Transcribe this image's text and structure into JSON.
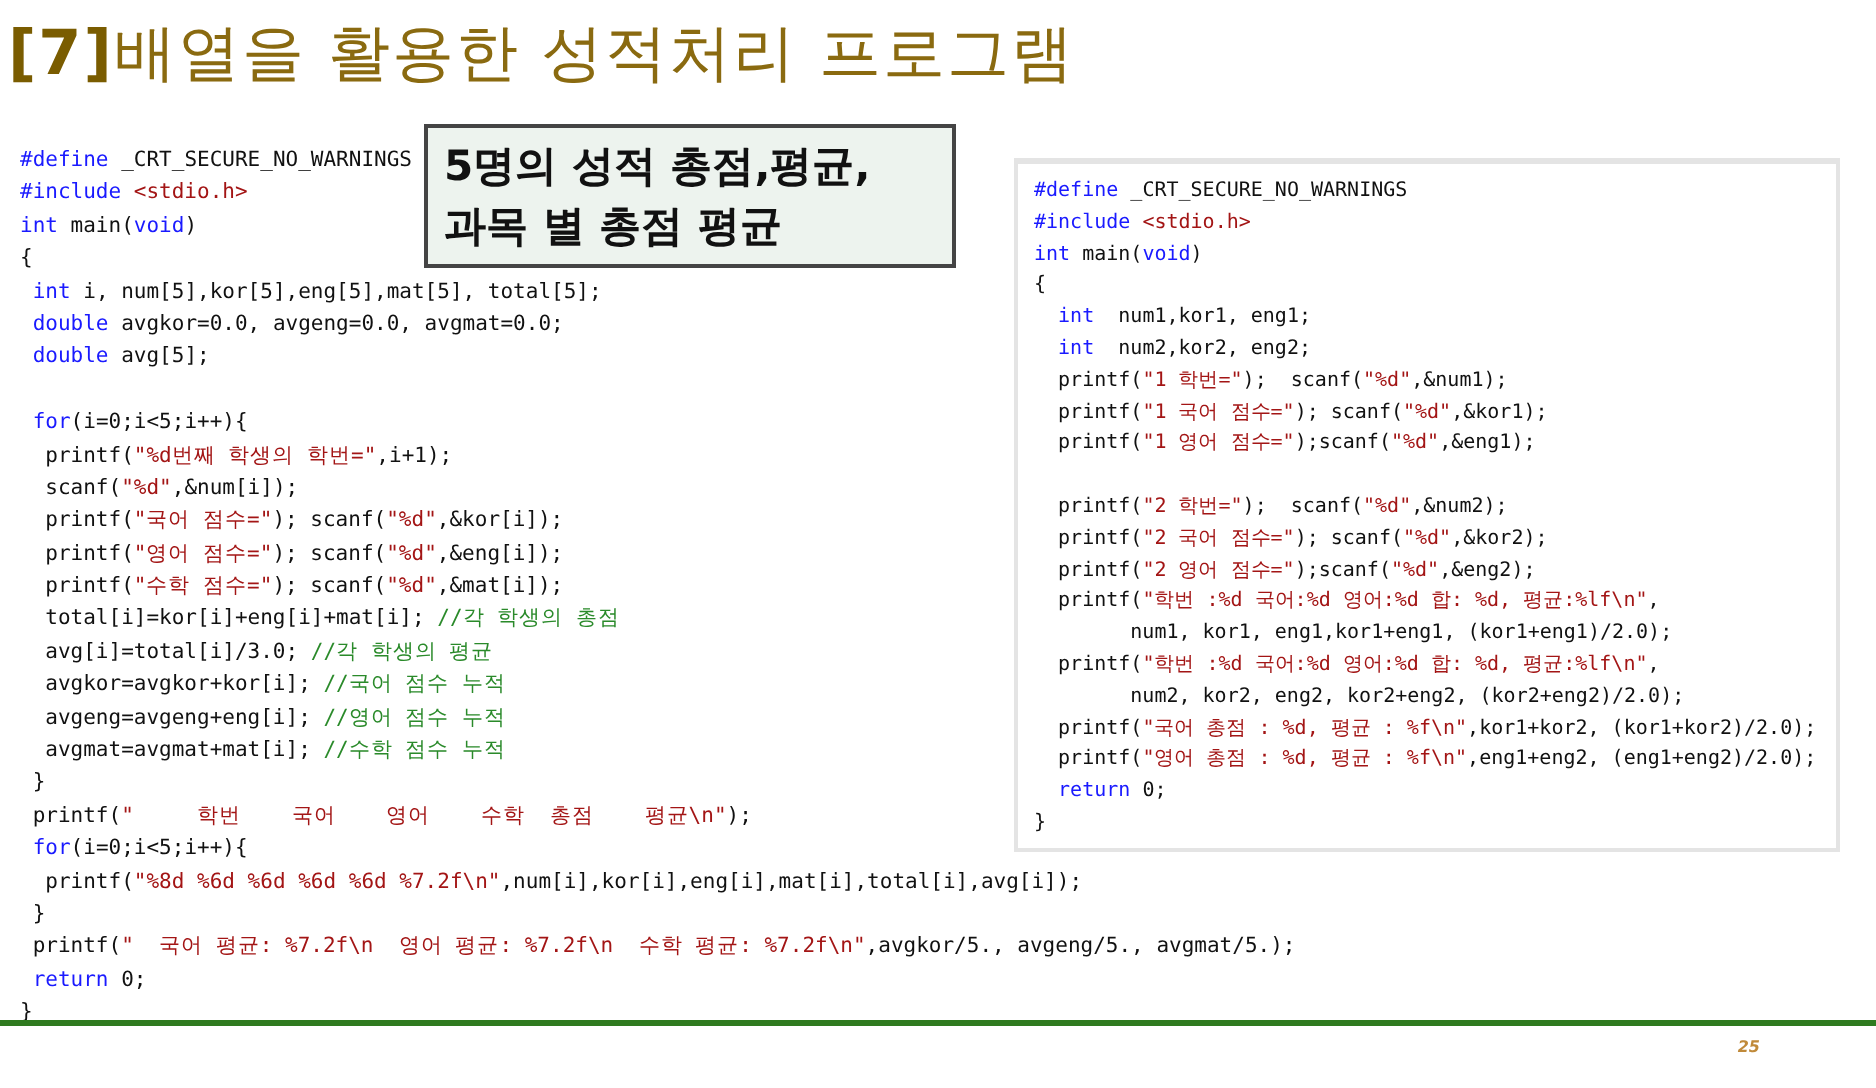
{
  "title": "**[7]**배열을 활용한 성적처리 프로그램",
  "callout": {
    "lines": [
      "5명의 성적 총점,평균,",
      "과목 별 총점 평균"
    ]
  },
  "left_code": [
    {
      "kind": "code",
      "segments": [
        {
          "kind": "kw",
          "text": "#define"
        },
        {
          "kind": "txt",
          "text": " _CRT_SECURE_NO_WARNINGS"
        }
      ]
    },
    {
      "kind": "code",
      "segments": [
        {
          "kind": "kw",
          "text": "#include"
        },
        {
          "kind": "str",
          "text": " <stdio.h>"
        }
      ]
    },
    {
      "kind": "code",
      "segments": [
        {
          "kind": "kw",
          "text": "int"
        },
        {
          "kind": "txt",
          "text": " main("
        },
        {
          "kind": "kw",
          "text": "void"
        },
        {
          "kind": "txt",
          "text": ")"
        }
      ]
    },
    {
      "kind": "code",
      "segments": [
        {
          "kind": "txt",
          "text": "{"
        }
      ]
    },
    {
      "kind": "code",
      "segments": [
        {
          "kind": "kw",
          "text": " int"
        },
        {
          "kind": "txt",
          "text": " i, num[5],kor[5],eng[5],mat[5], total[5];"
        }
      ]
    },
    {
      "kind": "code",
      "segments": [
        {
          "kind": "kw",
          "text": " double"
        },
        {
          "kind": "txt",
          "text": " avgkor=0.0, avgeng=0.0, avgmat=0.0;"
        }
      ]
    },
    {
      "kind": "code",
      "segments": [
        {
          "kind": "kw",
          "text": " double"
        },
        {
          "kind": "txt",
          "text": " avg[5];"
        }
      ]
    },
    {
      "kind": "blank"
    },
    {
      "kind": "code",
      "segments": [
        {
          "kind": "kw",
          "text": " for"
        },
        {
          "kind": "txt",
          "text": "(i=0;i<5;i++){"
        }
      ]
    },
    {
      "kind": "code",
      "segments": [
        {
          "kind": "txt",
          "text": "  printf("
        },
        {
          "kind": "str",
          "text": "\"%d번째 학생의 학번=\""
        },
        {
          "kind": "txt",
          "text": ",i+1);"
        }
      ]
    },
    {
      "kind": "code",
      "segments": [
        {
          "kind": "txt",
          "text": "  scanf("
        },
        {
          "kind": "str",
          "text": "\"%d\""
        },
        {
          "kind": "txt",
          "text": ",&num[i]);"
        }
      ]
    },
    {
      "kind": "code",
      "segments": [
        {
          "kind": "txt",
          "text": "  printf("
        },
        {
          "kind": "str",
          "text": "\"국어 점수=\""
        },
        {
          "kind": "txt",
          "text": "); scanf("
        },
        {
          "kind": "str",
          "text": "\"%d\""
        },
        {
          "kind": "txt",
          "text": ",&kor[i]);"
        }
      ]
    },
    {
      "kind": "code",
      "segments": [
        {
          "kind": "txt",
          "text": "  printf("
        },
        {
          "kind": "str",
          "text": "\"영어 점수=\""
        },
        {
          "kind": "txt",
          "text": "); scanf("
        },
        {
          "kind": "str",
          "text": "\"%d\""
        },
        {
          "kind": "txt",
          "text": ",&eng[i]);"
        }
      ]
    },
    {
      "kind": "code",
      "segments": [
        {
          "kind": "txt",
          "text": "  printf("
        },
        {
          "kind": "str",
          "text": "\"수학 점수=\""
        },
        {
          "kind": "txt",
          "text": "); scanf("
        },
        {
          "kind": "str",
          "text": "\"%d\""
        },
        {
          "kind": "txt",
          "text": ",&mat[i]);"
        }
      ]
    },
    {
      "kind": "code",
      "segments": [
        {
          "kind": "txt",
          "text": "  total[i]=kor[i]+eng[i]+mat[i]; "
        },
        {
          "kind": "cmt",
          "text": "//각 학생의 총점"
        }
      ]
    },
    {
      "kind": "code",
      "segments": [
        {
          "kind": "txt",
          "text": "  avg[i]=total[i]/3.0; "
        },
        {
          "kind": "cmt",
          "text": "//각 학생의 평균"
        }
      ]
    },
    {
      "kind": "code",
      "segments": [
        {
          "kind": "txt",
          "text": "  avgkor=avgkor+kor[i]; "
        },
        {
          "kind": "cmt",
          "text": "//국어 점수 누적"
        }
      ]
    },
    {
      "kind": "code",
      "segments": [
        {
          "kind": "txt",
          "text": "  avgeng=avgeng+eng[i]; "
        },
        {
          "kind": "cmt",
          "text": "//영어 점수 누적"
        }
      ]
    },
    {
      "kind": "code",
      "segments": [
        {
          "kind": "txt",
          "text": "  avgmat=avgmat+mat[i]; "
        },
        {
          "kind": "cmt",
          "text": "//수학 점수 누적"
        }
      ]
    },
    {
      "kind": "code",
      "segments": [
        {
          "kind": "txt",
          "text": " }"
        }
      ]
    },
    {
      "kind": "code",
      "segments": [
        {
          "kind": "txt",
          "text": " printf("
        },
        {
          "kind": "str",
          "text": "\"     학번    국어    영어    수학  총점    평균\\n\""
        },
        {
          "kind": "txt",
          "text": ");"
        }
      ]
    },
    {
      "kind": "code",
      "segments": [
        {
          "kind": "kw",
          "text": " for"
        },
        {
          "kind": "txt",
          "text": "(i=0;i<5;i++){"
        }
      ]
    },
    {
      "kind": "code",
      "segments": [
        {
          "kind": "txt",
          "text": "  printf("
        },
        {
          "kind": "str",
          "text": "\"%8d %6d %6d %6d %6d %7.2f\\n\""
        },
        {
          "kind": "txt",
          "text": ",num[i],kor[i],eng[i],mat[i],total[i],avg[i]);"
        }
      ]
    },
    {
      "kind": "code",
      "segments": [
        {
          "kind": "txt",
          "text": " }"
        }
      ]
    },
    {
      "kind": "code",
      "segments": [
        {
          "kind": "txt",
          "text": " printf("
        },
        {
          "kind": "str",
          "text": "\"  국어 평균: %7.2f\\n  영어 평균: %7.2f\\n  수학 평균: %7.2f\\n\""
        },
        {
          "kind": "txt",
          "text": ",avgkor/5., avgeng/5., avgmat/5.);"
        }
      ]
    },
    {
      "kind": "code",
      "segments": [
        {
          "kind": "kw",
          "text": " return"
        },
        {
          "kind": "txt",
          "text": " 0;"
        }
      ]
    },
    {
      "kind": "code",
      "segments": [
        {
          "kind": "txt",
          "text": "}"
        }
      ]
    }
  ],
  "right_code": [
    {
      "kind": "code",
      "segments": [
        {
          "kind": "kw",
          "text": "#define"
        },
        {
          "kind": "txt",
          "text": " _CRT_SECURE_NO_WARNINGS"
        }
      ]
    },
    {
      "kind": "code",
      "segments": [
        {
          "kind": "kw",
          "text": "#include"
        },
        {
          "kind": "str",
          "text": " <stdio.h>"
        }
      ]
    },
    {
      "kind": "code",
      "segments": [
        {
          "kind": "kw",
          "text": "int"
        },
        {
          "kind": "txt",
          "text": " main("
        },
        {
          "kind": "kw",
          "text": "void"
        },
        {
          "kind": "txt",
          "text": ")"
        }
      ]
    },
    {
      "kind": "code",
      "segments": [
        {
          "kind": "txt",
          "text": "{"
        }
      ]
    },
    {
      "kind": "code",
      "segments": [
        {
          "kind": "kw",
          "text": "  int"
        },
        {
          "kind": "txt",
          "text": "  num1,kor1, eng1;"
        }
      ]
    },
    {
      "kind": "code",
      "segments": [
        {
          "kind": "kw",
          "text": "  int"
        },
        {
          "kind": "txt",
          "text": "  num2,kor2, eng2;"
        }
      ]
    },
    {
      "kind": "code",
      "segments": [
        {
          "kind": "txt",
          "text": "  printf("
        },
        {
          "kind": "str",
          "text": "\"1 학번=\""
        },
        {
          "kind": "txt",
          "text": ");  scanf("
        },
        {
          "kind": "str",
          "text": "\"%d\""
        },
        {
          "kind": "txt",
          "text": ",&num1);"
        }
      ]
    },
    {
      "kind": "code",
      "segments": [
        {
          "kind": "txt",
          "text": "  printf("
        },
        {
          "kind": "str",
          "text": "\"1 국어 점수=\""
        },
        {
          "kind": "txt",
          "text": "); scanf("
        },
        {
          "kind": "str",
          "text": "\"%d\""
        },
        {
          "kind": "txt",
          "text": ",&kor1);"
        }
      ]
    },
    {
      "kind": "code",
      "segments": [
        {
          "kind": "txt",
          "text": "  printf("
        },
        {
          "kind": "str",
          "text": "\"1 영어 점수=\""
        },
        {
          "kind": "txt",
          "text": ");scanf("
        },
        {
          "kind": "str",
          "text": "\"%d\""
        },
        {
          "kind": "txt",
          "text": ",&eng1);"
        }
      ]
    },
    {
      "kind": "blank"
    },
    {
      "kind": "code",
      "segments": [
        {
          "kind": "txt",
          "text": "  printf("
        },
        {
          "kind": "str",
          "text": "\"2 학번=\""
        },
        {
          "kind": "txt",
          "text": ");  scanf("
        },
        {
          "kind": "str",
          "text": "\"%d\""
        },
        {
          "kind": "txt",
          "text": ",&num2);"
        }
      ]
    },
    {
      "kind": "code",
      "segments": [
        {
          "kind": "txt",
          "text": "  printf("
        },
        {
          "kind": "str",
          "text": "\"2 국어 점수=\""
        },
        {
          "kind": "txt",
          "text": "); scanf("
        },
        {
          "kind": "str",
          "text": "\"%d\""
        },
        {
          "kind": "txt",
          "text": ",&kor2);"
        }
      ]
    },
    {
      "kind": "code",
      "segments": [
        {
          "kind": "txt",
          "text": "  printf("
        },
        {
          "kind": "str",
          "text": "\"2 영어 점수=\""
        },
        {
          "kind": "txt",
          "text": ");scanf("
        },
        {
          "kind": "str",
          "text": "\"%d\""
        },
        {
          "kind": "txt",
          "text": ",&eng2);"
        }
      ]
    },
    {
      "kind": "code",
      "segments": [
        {
          "kind": "txt",
          "text": "  printf("
        },
        {
          "kind": "str",
          "text": "\"학번 :%d 국어:%d 영어:%d 합: %d, 평균:%lf\\n\""
        },
        {
          "kind": "txt",
          "text": ","
        }
      ]
    },
    {
      "kind": "code",
      "segments": [
        {
          "kind": "txt",
          "text": "        num1, kor1, eng1,kor1+eng1, (kor1+eng1)/2.0);"
        }
      ]
    },
    {
      "kind": "code",
      "segments": [
        {
          "kind": "txt",
          "text": "  printf("
        },
        {
          "kind": "str",
          "text": "\"학번 :%d 국어:%d 영어:%d 합: %d, 평균:%lf\\n\""
        },
        {
          "kind": "txt",
          "text": ","
        }
      ]
    },
    {
      "kind": "code",
      "segments": [
        {
          "kind": "txt",
          "text": "        num2, kor2, eng2, kor2+eng2, (kor2+eng2)/2.0);"
        }
      ]
    },
    {
      "kind": "code",
      "segments": [
        {
          "kind": "txt",
          "text": "  printf("
        },
        {
          "kind": "str",
          "text": "\"국어 총점 : %d, 평균 : %f\\n\""
        },
        {
          "kind": "txt",
          "text": ",kor1+kor2, (kor1+kor2)/2.0);"
        }
      ]
    },
    {
      "kind": "code",
      "segments": [
        {
          "kind": "txt",
          "text": "  printf("
        },
        {
          "kind": "str",
          "text": "\"영어 총점 : %d, 평균 : %f\\n\""
        },
        {
          "kind": "txt",
          "text": ",eng1+eng2, (eng1+eng2)/2.0);"
        }
      ]
    },
    {
      "kind": "code",
      "segments": [
        {
          "kind": "kw",
          "text": "  return"
        },
        {
          "kind": "txt",
          "text": " 0;"
        }
      ]
    },
    {
      "kind": "code",
      "segments": [
        {
          "kind": "txt",
          "text": "}"
        }
      ]
    }
  ],
  "page_number": "25"
}
